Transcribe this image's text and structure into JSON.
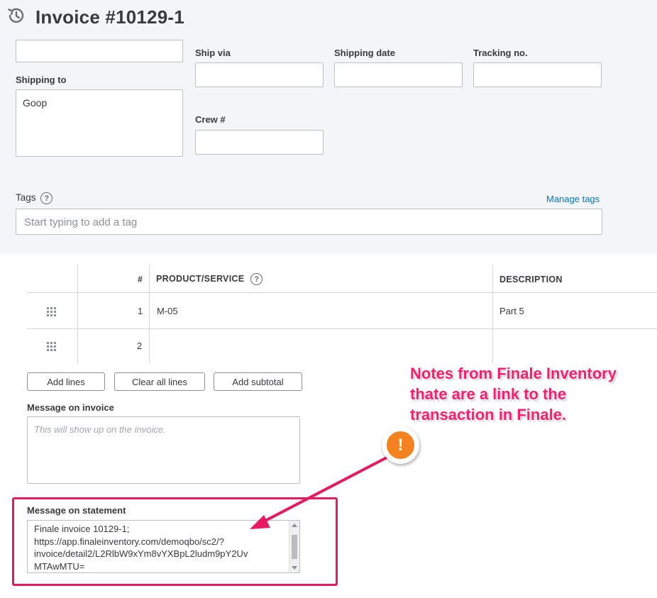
{
  "header": {
    "title": "Invoice #10129-1",
    "icon": "recent-history-icon"
  },
  "form": {
    "ship_via_label": "Ship via",
    "shipping_date_label": "Shipping date",
    "tracking_label": "Tracking no.",
    "shipping_to_label": "Shipping to",
    "shipping_to_value": "Goop",
    "crew_label": "Crew #",
    "tags_label": "Tags",
    "manage_tags": "Manage tags",
    "tags_placeholder": "Start typing to add a tag"
  },
  "table": {
    "columns": {
      "num": "#",
      "product": "PRODUCT/SERVICE",
      "description": "DESCRIPTION"
    },
    "rows": [
      {
        "num": "1",
        "product": "M-05",
        "description": "Part 5"
      },
      {
        "num": "2",
        "product": "",
        "description": ""
      }
    ]
  },
  "buttons": {
    "add_lines": "Add lines",
    "clear_all_lines": "Clear all lines",
    "add_subtotal": "Add subtotal"
  },
  "message_invoice": {
    "label": "Message on invoice",
    "placeholder": "This will show up on the invoice."
  },
  "message_statement": {
    "label": "Message on statement",
    "value": "Finale invoice 10129-1;\nhttps://app.finaleinventory.com/demoqbo/sc2/?\ninvoice/detail2/L2RlbW9xYm8vYXBpL2ludm9pY2Uv\nMTAwMTU="
  },
  "annotation": {
    "note_line1": "Notes from Finale Inventory",
    "note_line2": "thate are a link to the",
    "note_line3": "transaction in Finale.",
    "badge": "!",
    "colors": {
      "accent": "#e8195f",
      "badge": "#f5821f"
    }
  }
}
